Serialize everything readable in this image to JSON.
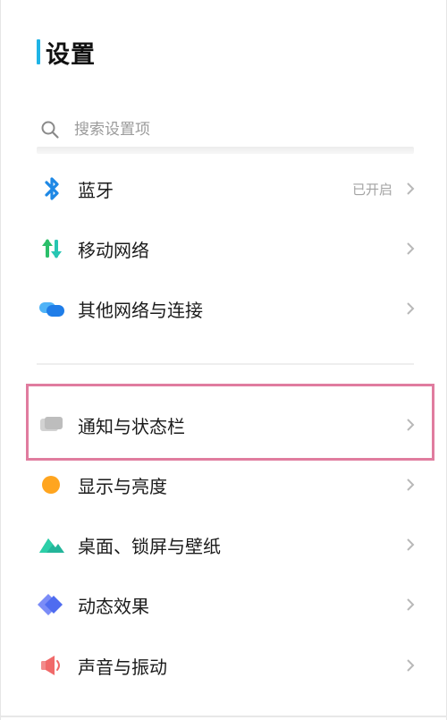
{
  "header": {
    "title": "设置"
  },
  "search": {
    "placeholder": "搜索设置项"
  },
  "group1": {
    "bluetooth": {
      "label": "蓝牙",
      "status": "已开启"
    },
    "mobile_network": {
      "label": "移动网络"
    },
    "other_network": {
      "label": "其他网络与连接"
    }
  },
  "group2": {
    "notification": {
      "label": "通知与状态栏"
    },
    "display": {
      "label": "显示与亮度"
    },
    "wallpaper": {
      "label": "桌面、锁屏与壁纸"
    },
    "animation": {
      "label": "动态效果"
    },
    "sound": {
      "label": "声音与振动"
    }
  },
  "colors": {
    "accent_bar": "#1fb4e6",
    "highlight_box": "#e07c9f",
    "bluetooth_icon": "#1e88e5",
    "mobile_icon": "#2bbf6a",
    "other_network_icon": "#2d8cf0",
    "notification_icon": "#bdbdbd",
    "display_icon": "#ffa51f",
    "wallpaper_icon": "#23b59a",
    "animation_icon": "#5c7cf5",
    "sound_icon": "#f06a6a"
  }
}
